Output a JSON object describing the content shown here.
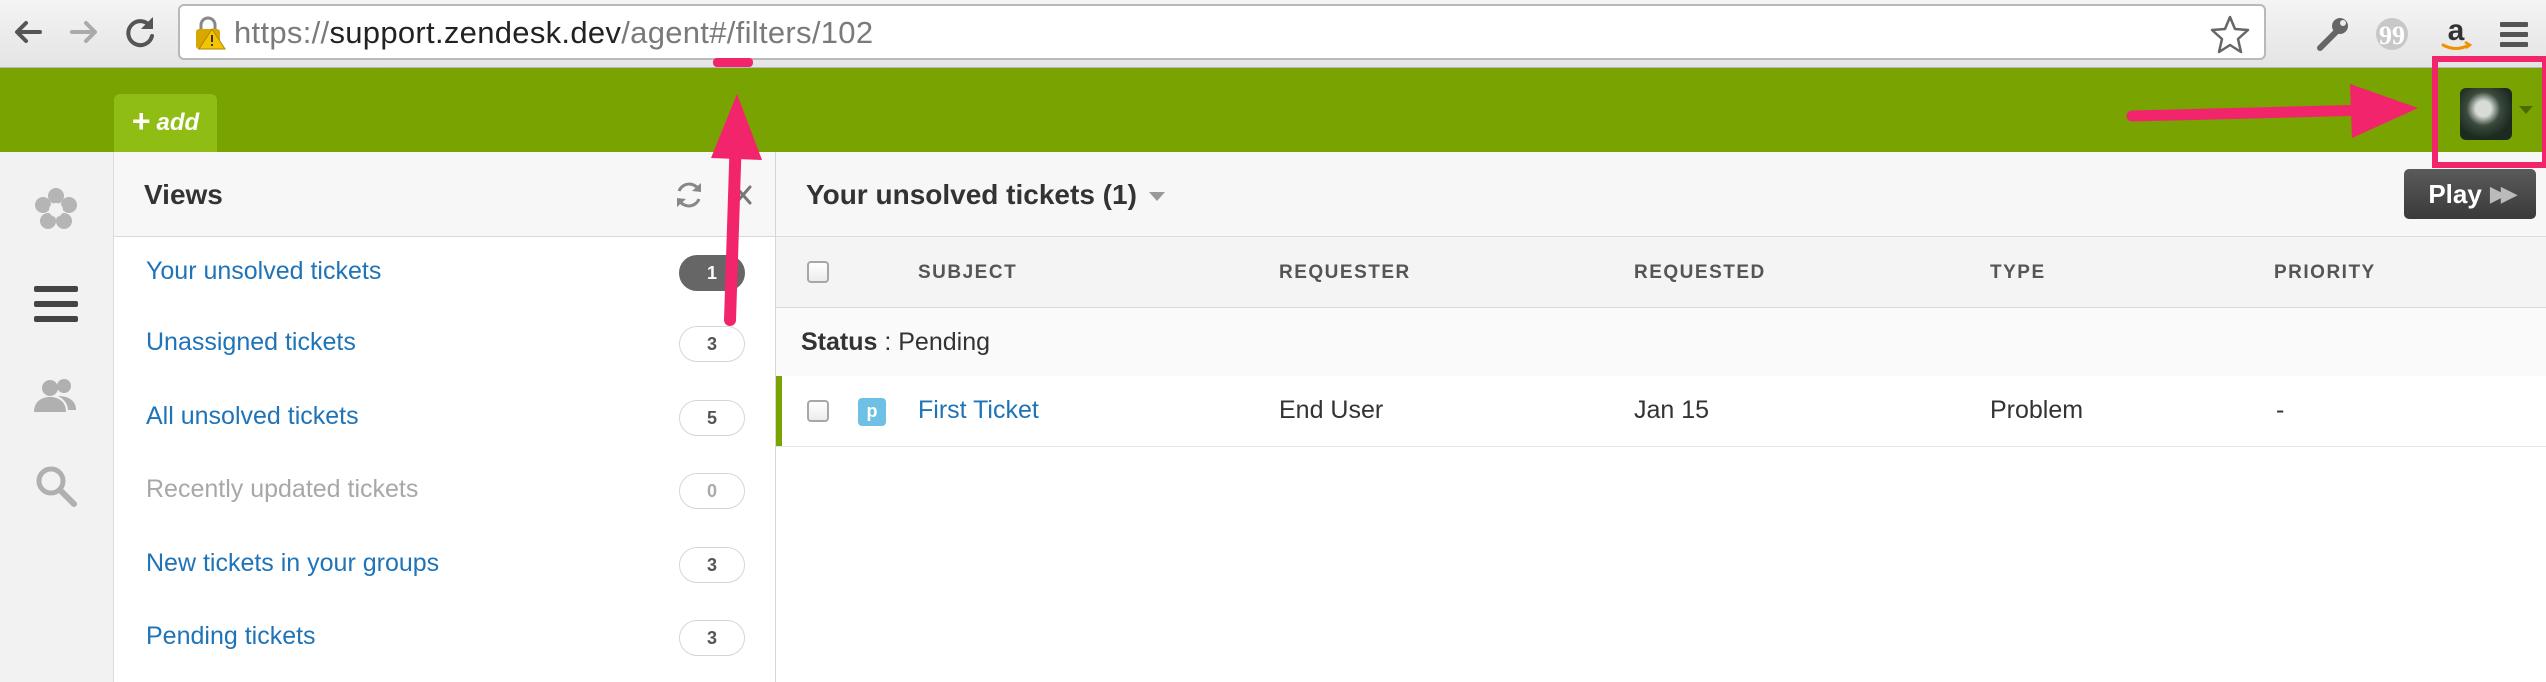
{
  "browser": {
    "url_prefix": "https://",
    "url_host": "support.zendesk.dev",
    "url_path": "/agent#/filters/102"
  },
  "header": {
    "add_label": "add",
    "add_plus": "+"
  },
  "views_panel": {
    "title": "Views",
    "items": [
      {
        "label": "Your unsolved tickets",
        "count": "1"
      },
      {
        "label": "Unassigned tickets",
        "count": "3"
      },
      {
        "label": "All unsolved tickets",
        "count": "5"
      },
      {
        "label": "Recently updated tickets",
        "count": "0"
      },
      {
        "label": "New tickets in your groups",
        "count": "3"
      },
      {
        "label": "Pending tickets",
        "count": "3"
      }
    ]
  },
  "main": {
    "title": "Your unsolved tickets (1)",
    "play_label": "Play",
    "columns": {
      "subject": "SUBJECT",
      "requester": "REQUESTER",
      "requested": "REQUESTED",
      "type": "TYPE",
      "priority": "PRIORITY"
    },
    "group": {
      "key": "Status",
      "separator": " : ",
      "value": "Pending"
    },
    "tickets": [
      {
        "status_letter": "p",
        "subject": "First Ticket",
        "requester": "End User",
        "requested": "Jan 15",
        "type": "Problem",
        "priority": "-"
      }
    ]
  },
  "icons": {
    "back": "back-arrow-icon",
    "forward": "forward-arrow-icon",
    "reload": "reload-icon",
    "lock": "security-warning-icon",
    "bookmark": "star-icon",
    "wrench": "wrench-icon",
    "quote": "quote-icon",
    "amazon": "amazon-icon",
    "menu": "hamburger-menu-icon",
    "rail": [
      "zendesk-logo-icon",
      "views-icon",
      "customers-icon",
      "search-icon"
    ]
  },
  "colors": {
    "brand_green": "#78a300",
    "add_tab": "#8fbd14",
    "link_blue": "#1f73b7",
    "annotation_pink": "#f2246b",
    "pending_badge": "#6ec1e4"
  }
}
